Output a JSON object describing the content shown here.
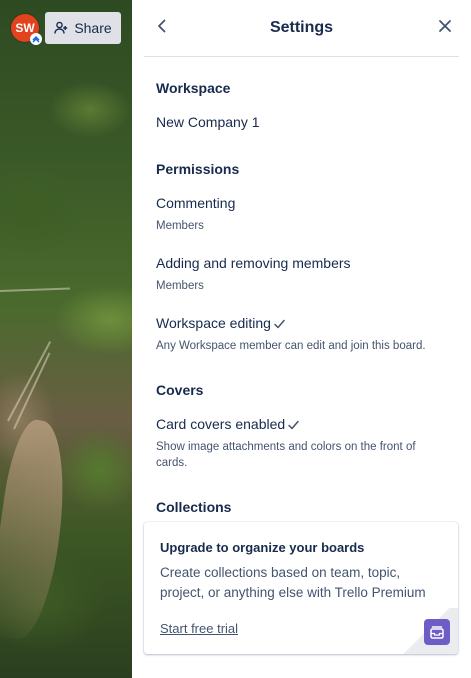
{
  "header": {
    "avatar_initials": "SW",
    "share_label": "Share"
  },
  "panel": {
    "title": "Settings",
    "back_icon": "chevron-left-icon",
    "close_icon": "close-icon"
  },
  "workspace": {
    "heading": "Workspace",
    "name": "New Company 1"
  },
  "permissions": {
    "heading": "Permissions",
    "commenting": {
      "label": "Commenting",
      "value": "Members"
    },
    "members": {
      "label": "Adding and removing members",
      "value": "Members"
    },
    "editing": {
      "label": "Workspace editing",
      "checked": true,
      "description": "Any Workspace member can edit and join this board."
    }
  },
  "covers": {
    "heading": "Covers",
    "card_covers": {
      "label": "Card covers enabled",
      "checked": true,
      "description": "Show image attachments and colors on the front of cards."
    }
  },
  "collections": {
    "heading": "Collections",
    "upgrade": {
      "title": "Upgrade to organize your boards",
      "body": "Create collections based on team, topic, project, or anything else with Trello Premium",
      "link": "Start free trial",
      "icon": "collection-icon"
    }
  },
  "colors": {
    "avatar": "#e2421e",
    "share_button": "#dfe1e6",
    "text": "#172b4d",
    "subtext": "#44546f",
    "premium_icon": "#6e5dc6"
  }
}
